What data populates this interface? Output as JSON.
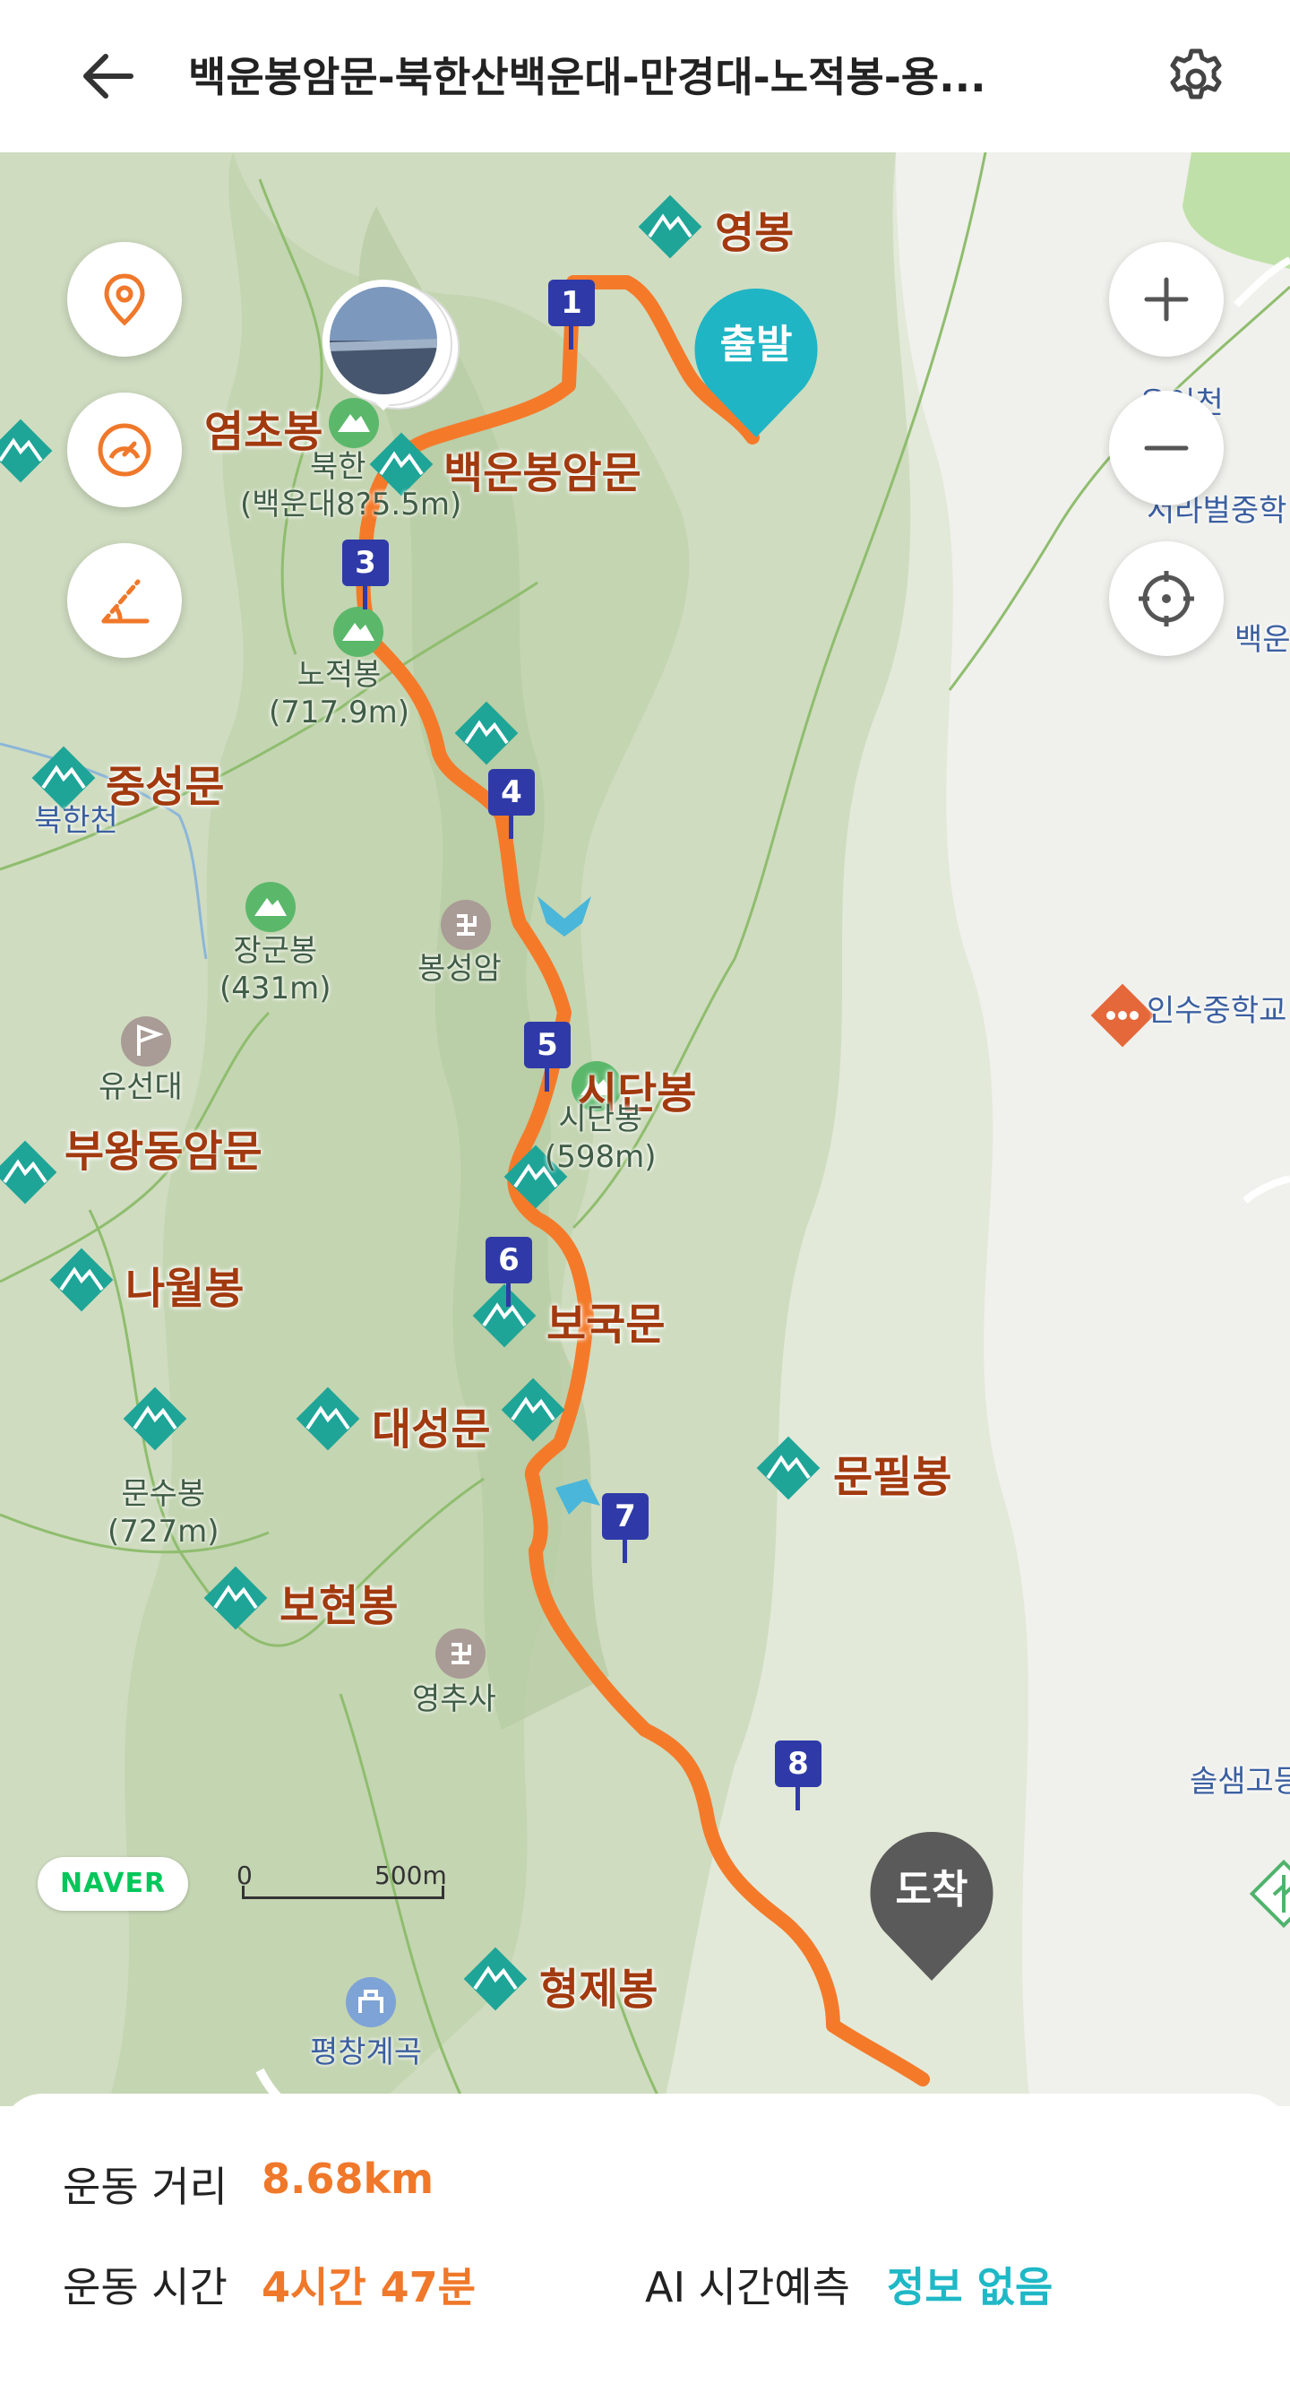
{
  "header": {
    "title": "백운봉암문-북한산백운대-만경대-노적봉-용...",
    "back_icon": "arrow-left-icon",
    "settings_icon": "gear-icon"
  },
  "map": {
    "peaks": [
      {
        "name": "영봉"
      },
      {
        "name": "염초봉"
      },
      {
        "name": "백운봉암문"
      },
      {
        "name": "중성문"
      },
      {
        "name": "시단봉"
      },
      {
        "name": "부왕동암문"
      },
      {
        "name": "나월봉"
      },
      {
        "name": "보국문"
      },
      {
        "name": "대성문"
      },
      {
        "name": "문필봉"
      },
      {
        "name": "보현봉"
      },
      {
        "name": "형제봉"
      }
    ],
    "summits": [
      {
        "name": "북한",
        "height": "(백운대8?5.5m)"
      },
      {
        "name": "노적봉",
        "height": "(717.9m)"
      },
      {
        "name": "장군봉",
        "height": "(431m)"
      },
      {
        "name": "시단봉",
        "height": "(598m)"
      },
      {
        "name": "문수봉",
        "height": "(727m)"
      }
    ],
    "places": {
      "bukhancheon": "북한천",
      "bongseongam": "봉성암",
      "yuseondae": "유선대",
      "yeongchusa": "영추사",
      "pyeongchang": "평창계곡",
      "insu_school": "인수중학교",
      "solsaem": "솔샘고등",
      "seorabeol": "서라벌중학",
      "ucheon": "우이천",
      "baegun": "백운"
    },
    "waypoints": [
      "1",
      "3",
      "4",
      "5",
      "6",
      "7",
      "8"
    ],
    "start_label": "출발",
    "end_label": "도착",
    "naver_logo": "NAVER",
    "scale_zero": "0",
    "scale_distance": "500m",
    "route_color": "#f47a2a",
    "start_color": "#1fb5c4",
    "end_color": "#5a5a5a",
    "controls": {
      "location_pin_icon": "location-pin-icon",
      "speedometer_icon": "speedometer-icon",
      "slope_icon": "slope-icon",
      "zoom_in_icon": "plus-icon",
      "zoom_out_icon": "minus-icon",
      "locate_icon": "crosshair-icon"
    }
  },
  "stats": {
    "distance_label": "운동 거리",
    "distance_value": "8.68km",
    "time_label": "운동 시간",
    "time_value": "4시간 47분",
    "ai_label": "AI 시간예측",
    "ai_value": "정보 없음"
  }
}
